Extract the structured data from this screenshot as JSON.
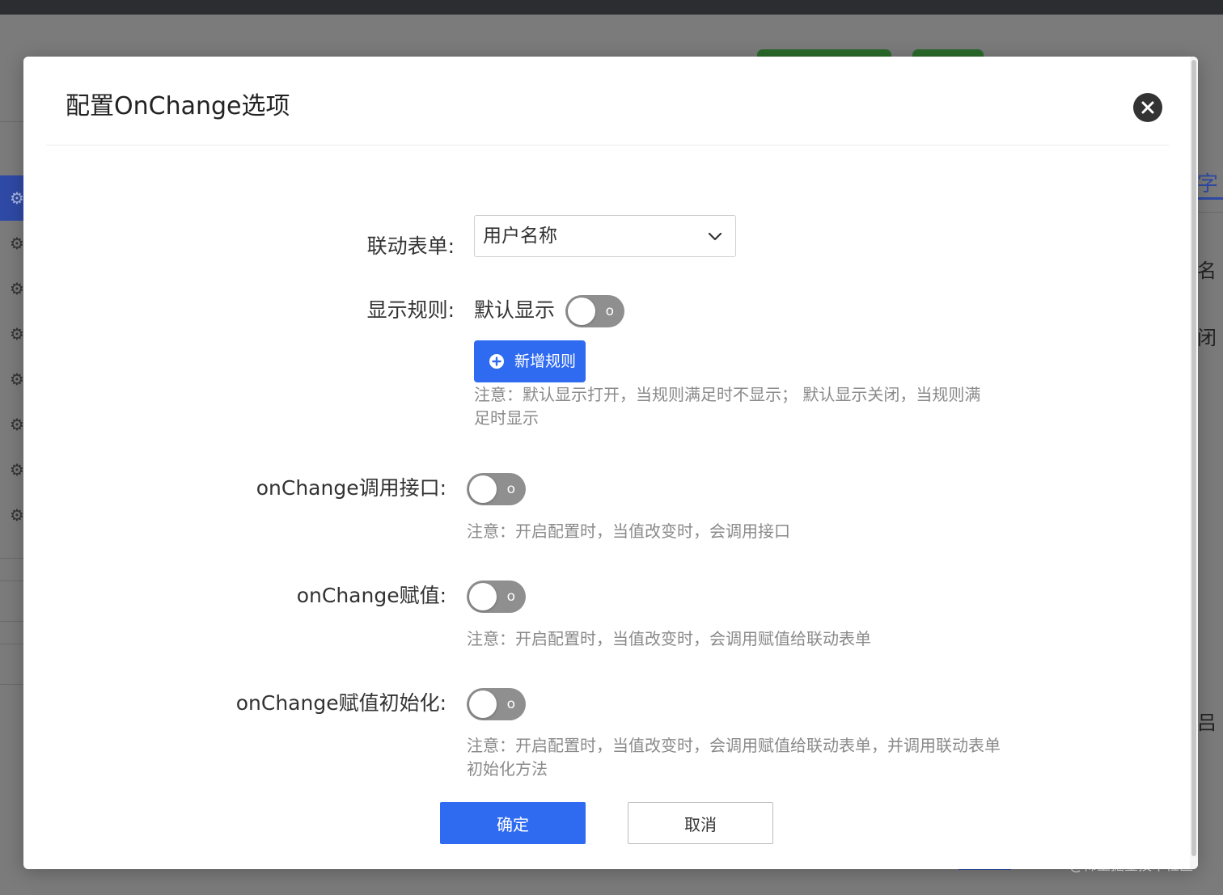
{
  "background": {
    "right_tab_label": "字",
    "right_texts": [
      "名",
      "闭",
      "吕"
    ],
    "watermark": "@稀土掘金技术社区"
  },
  "modal": {
    "title": "配置OnChange选项",
    "close_icon": "close-icon",
    "linked_form": {
      "label": "联动表单:",
      "selected": "用户名称"
    },
    "display_rule": {
      "label": "显示规则:",
      "default_text": "默认显示",
      "toggle_text": "o",
      "add_rule_label": "新增规则",
      "note_line1": "注意：默认显示打开，当规则满足时不显示； 默认显示关闭，当规则满",
      "note_line2": "足时显示"
    },
    "call_api": {
      "label": "onChange调用接口:",
      "toggle_text": "o",
      "note": "注意：开启配置时，当值改变时，会调用接口"
    },
    "assign": {
      "label": "onChange赋值:",
      "toggle_text": "o",
      "note": "注意：开启配置时，当值改变时，会调用赋值给联动表单"
    },
    "assign_init": {
      "label": "onChange赋值初始化:",
      "toggle_text": "o",
      "note_line1": "注意：开启配置时，当值改变时，会调用赋值给联动表单，并调用联动表单",
      "note_line2": "初始化方法"
    },
    "footer": {
      "confirm_label": "确定",
      "cancel_label": "取消"
    }
  },
  "colors": {
    "primary": "#2f6bf1",
    "toggle_off": "#8f8f8f",
    "note_text": "#8a8a8a"
  }
}
